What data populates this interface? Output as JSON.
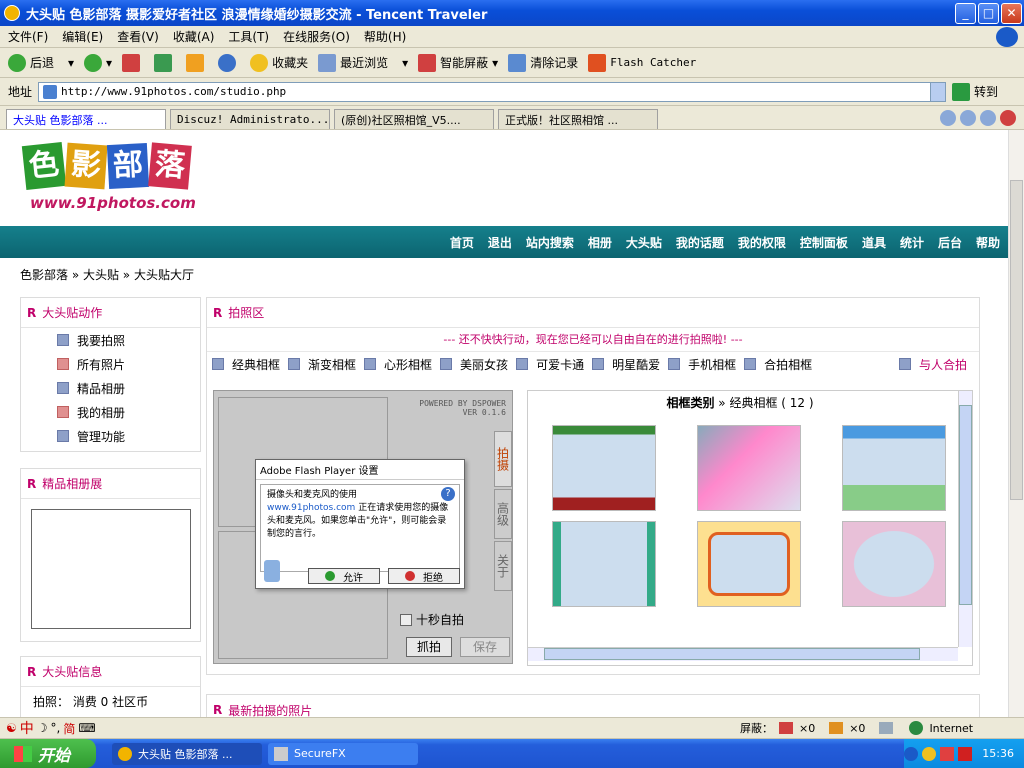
{
  "window": {
    "title": "大头贴 色影部落 摄影爱好者社区 浪漫情缘婚纱摄影交流 - Tencent Traveler"
  },
  "menu": [
    "文件(F)",
    "编辑(E)",
    "查看(V)",
    "收藏(A)",
    "工具(T)",
    "在线服务(O)",
    "帮助(H)"
  ],
  "toolbar": {
    "back": "后退",
    "favorites": "收藏夹",
    "recent": "最近浏览",
    "smart_block": "智能屏蔽",
    "clear": "清除记录",
    "flash": "Flash Catcher"
  },
  "address": {
    "label": "地址",
    "url": "http://www.91photos.com/studio.php",
    "go": "转到"
  },
  "tabs": [
    "大头贴 色影部落 ...",
    "Discuz! Administrato...",
    "(原创)社区照相馆_V5....",
    "正式版！社区照相馆 ..."
  ],
  "site": {
    "logo": "色影部落",
    "logo_url": "www.91photos.com",
    "nav": [
      "首页",
      "退出",
      "站内搜索",
      "相册",
      "大头贴",
      "我的话题",
      "我的权限",
      "控制面板",
      "道具",
      "统计",
      "后台",
      "帮助"
    ],
    "breadcrumb": "色影部落 » 大头贴 » 大头贴大厅"
  },
  "sidebar": {
    "actions_title": "大头贴动作",
    "actions": [
      "我要拍照",
      "所有照片",
      "精品相册",
      "我的相册",
      "管理功能"
    ],
    "album_title": "精品相册展",
    "info_title": "大头贴信息",
    "info_line": "拍照： 消费 0 社区币"
  },
  "main": {
    "title": "拍照区",
    "notice": "--- 还不快快行动，现在您已经可以自由自在的进行拍照啦! ---",
    "categories": [
      "经典相框",
      "渐变相框",
      "心形相框",
      "美丽女孩",
      "可爱卡通",
      "明星酷爱",
      "手机相框",
      "合拍相框"
    ],
    "with_person": "与人合拍",
    "powered": "POWERED BY DSPOWER",
    "ver": "VER 0.1.6",
    "side_tabs": [
      "拍摄",
      "高级",
      "关于"
    ],
    "timer": "十秒自拍",
    "shoot": "抓拍",
    "save": "保存",
    "frame_header": "相框类别",
    "frame_category": "经典相框",
    "frame_count": "( 12 )",
    "latest_title": "最新拍摄的照片"
  },
  "flash_dialog": {
    "title": "Adobe Flash Player 设置",
    "heading": "摄像头和麦克风的使用",
    "link": "www.91photos.com",
    "text": "正在请求使用您的摄像头和麦克风。如果您单击\"允许\"，则可能会录制您的言行。",
    "allow": "允许",
    "deny": "拒绝"
  },
  "status": {
    "block": "屏蔽：",
    "count1": "×0",
    "count2": "×0",
    "zone": "Internet"
  },
  "taskbar": {
    "start": "开始",
    "items": [
      "大头贴 色影部落 ...",
      "SecureFX"
    ],
    "time": "15:36"
  },
  "ime": {
    "text": "中",
    "mode": "简"
  },
  "colors": {
    "accent": "#c0006a",
    "nav": "#0c6470"
  }
}
